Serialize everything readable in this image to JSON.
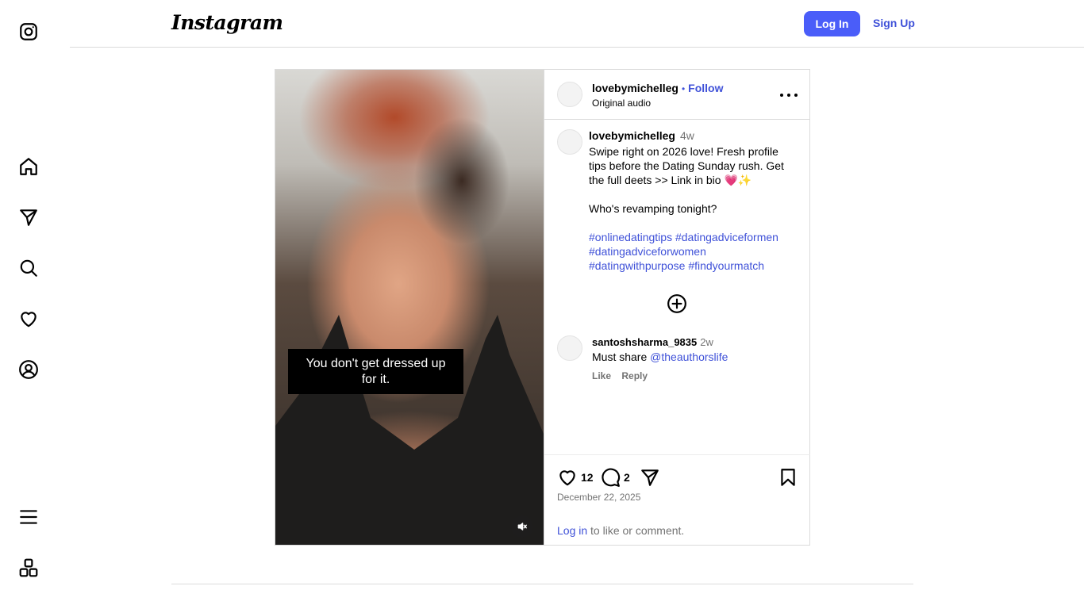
{
  "header": {
    "logo": "Instagram",
    "login_label": "Log In",
    "signup_label": "Sign Up"
  },
  "rail": {
    "icons": [
      "instagram-icon",
      "home-icon",
      "explore-icon",
      "search-icon",
      "heart-icon",
      "profile-icon",
      "menu-icon",
      "more-apps-icon"
    ]
  },
  "media": {
    "caption_line1": "You don't get dressed up",
    "caption_line2": "for it."
  },
  "post": {
    "username": "lovebymichelleg",
    "follow_label": "Follow",
    "audio": "Original audio",
    "caption": {
      "username": "lovebymichelleg",
      "age": "4w",
      "text": "Swipe right on 2026 love! Fresh profile tips before the Dating Sunday rush. Get the full deets >> Link in bio 💗✨",
      "question": "Who's revamping tonight?",
      "hashtags": [
        "#onlinedatingtips",
        "#datingadviceformen",
        "#datingadviceforwomen",
        "#datingwithpurpose",
        "#findyourmatch"
      ]
    },
    "comment": {
      "username": "santoshsharma_9835",
      "age": "2w",
      "text_prefix": "Must share ",
      "mention": "@theauthorslife",
      "like_label": "Like",
      "reply_label": "Reply"
    },
    "likes_count": "12",
    "comments_count": "2",
    "date": "December 22, 2025",
    "login_link": "Log in",
    "login_suffix": " to like or comment."
  },
  "colors": {
    "accent": "#4a5df9",
    "link": "#3f51d8",
    "border": "#dbdbdb",
    "muted": "#737373"
  }
}
